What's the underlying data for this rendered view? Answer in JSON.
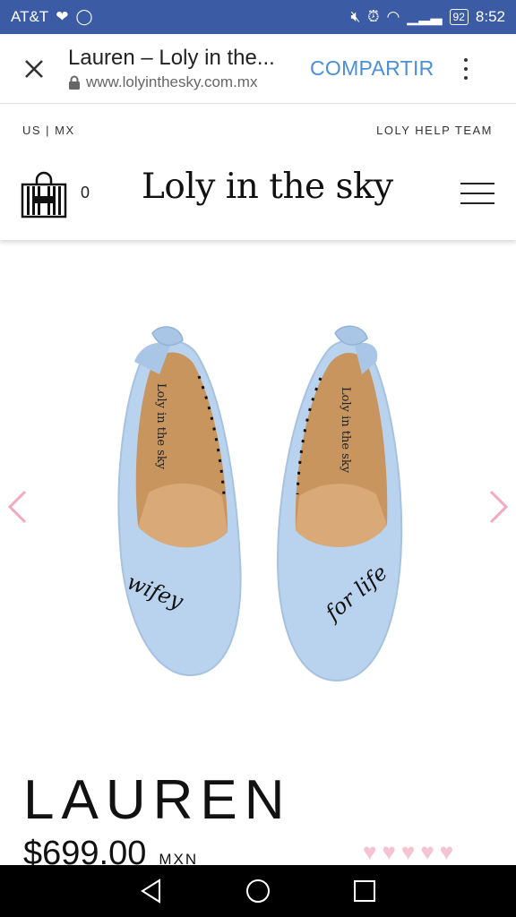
{
  "status_bar": {
    "carrier": "AT&T",
    "battery": "92",
    "time": "8:52"
  },
  "browser": {
    "page_title": "Lauren – Loly in the...",
    "url": "www.lolyinthesky.com.mx",
    "share_label": "COMPARTIR"
  },
  "site": {
    "region_label": "US | MX",
    "help_label": "LOLY HELP TEAM",
    "cart_count": "0",
    "logo_text": "Loly in the sky"
  },
  "product": {
    "name": "LAUREN",
    "price": "$699.00",
    "currency": "MXN",
    "rating_hearts": 5,
    "shoe_text_left": "wifey",
    "shoe_text_right": "for life",
    "insole_brand": "Loly in the sky"
  },
  "colors": {
    "status_bar": "#3b5ba5",
    "share": "#4a8fd8",
    "arrows": "#f2a9bd",
    "hearts": "#f5c4d2",
    "shoe_blue": "#b9d3ef"
  }
}
